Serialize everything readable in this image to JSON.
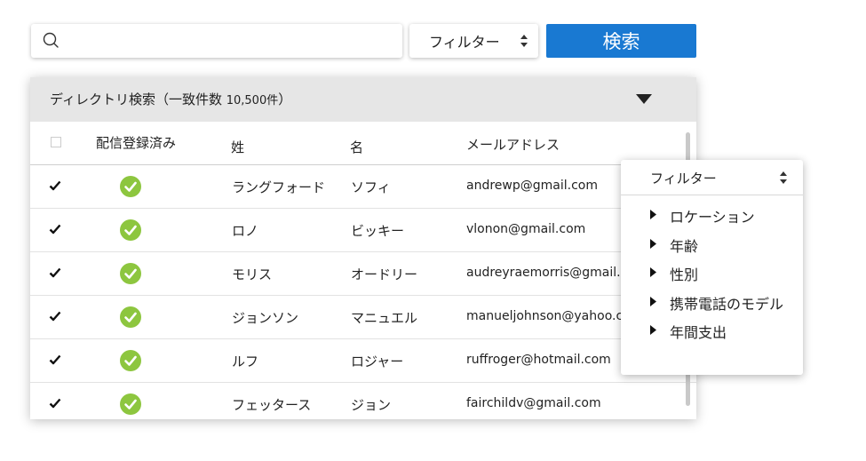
{
  "search": {
    "placeholder": "",
    "button_label": "検索"
  },
  "filter_select": {
    "label": "フィルター"
  },
  "directory": {
    "title": "ディレクトリ検索（一致件数 ",
    "count": "10,500件",
    "title_end": "）",
    "columns": [
      "配信登録済み",
      "姓",
      "名",
      "メールアドレス"
    ],
    "rows": [
      {
        "checked": true,
        "registered": true,
        "last": "ラングフォード",
        "first": "ソフィ",
        "email": "andrewp@gmail.com"
      },
      {
        "checked": true,
        "registered": true,
        "last": "ロノ",
        "first": "ビッキー",
        "email": "vlonon@gmail.com"
      },
      {
        "checked": true,
        "registered": true,
        "last": "モリス",
        "first": "オードリー",
        "email": "audreyraemorris@gmail.com"
      },
      {
        "checked": true,
        "registered": true,
        "last": "ジョンソン",
        "first": "マニュエル",
        "email": "manueljohnson@yahoo.com"
      },
      {
        "checked": true,
        "registered": true,
        "last": "ルフ",
        "first": "ロジャー",
        "email": "ruffroger@hotmail.com"
      },
      {
        "checked": true,
        "registered": true,
        "last": "フェッタース",
        "first": "ジョン",
        "email": "fairchildv@gmail.com"
      }
    ]
  },
  "filter_popup": {
    "title": "フィルター",
    "items": [
      "ロケーション",
      "年齢",
      "性別",
      "携帯電話のモデル",
      "年間支出"
    ]
  },
  "colors": {
    "accent": "#1979d2",
    "success": "#8dc63f",
    "header_bg": "#e6e6e6"
  },
  "icons": {
    "search": "search-icon",
    "collapse": "caret-down-icon",
    "status": "check-circle-icon",
    "row_check": "checkmark-icon",
    "popup_item": "caret-right-icon",
    "select": "up-down-arrows-icon"
  }
}
